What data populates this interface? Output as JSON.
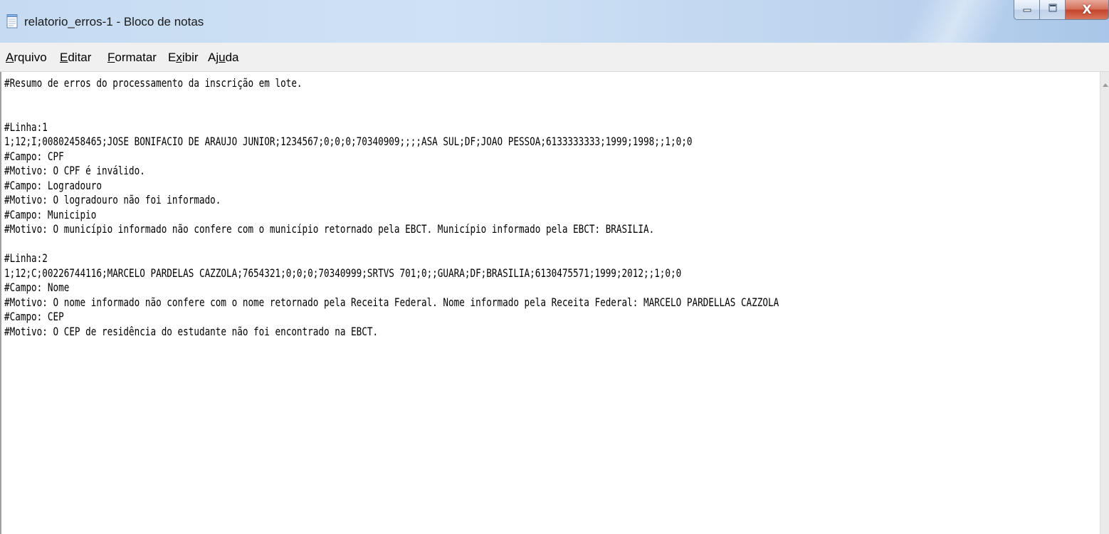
{
  "window": {
    "title": "relatorio_erros-1 - Bloco de notas",
    "icon": "notepad-icon",
    "caption": {
      "minimize_icon": "minimize-icon",
      "maximize_icon": "maximize-icon",
      "close_label": "X"
    }
  },
  "menubar": {
    "items": [
      {
        "label": "Arquivo",
        "accel": "A",
        "rest": "rquivo"
      },
      {
        "label": "Editar",
        "accel": "E",
        "rest": "ditar"
      },
      {
        "label": "Formatar",
        "accel": "F",
        "rest": "ormatar"
      },
      {
        "label": "Exibir",
        "pre": "E",
        "accel": "x",
        "rest": "ibir"
      },
      {
        "label": "Ajuda",
        "pre": "Aj",
        "accel": "u",
        "rest": "da"
      }
    ]
  },
  "editor": {
    "lines": [
      "#Resumo de erros do processamento da inscrição em lote.",
      "",
      "",
      "#Linha:1",
      "1;12;I;00802458465;JOSE BONIFACIO DE ARAUJO JUNIOR;1234567;0;0;0;70340909;;;;ASA SUL;DF;JOAO PESSOA;6133333333;1999;1998;;1;0;0",
      "#Campo: CPF",
      "#Motivo: O CPF é inválido.",
      "#Campo: Logradouro",
      "#Motivo: O logradouro não foi informado.",
      "#Campo: Municipio",
      "#Motivo: O município informado não confere com o município retornado pela EBCT. Município informado pela EBCT: BRASILIA.",
      "",
      "#Linha:2",
      "1;12;C;00226744116;MARCELO PARDELAS CAZZOLA;7654321;0;0;0;70340999;SRTVS 701;0;;GUARA;DF;BRASILIA;6130475571;1999;2012;;1;0;0",
      "#Campo: Nome",
      "#Motivo: O nome informado não confere com o nome retornado pela Receita Federal. Nome informado pela Receita Federal: MARCELO PARDELLAS CAZZOLA",
      "#Campo: CEP",
      "#Motivo: O CEP de residência do estudante não foi encontrado na EBCT."
    ]
  },
  "scrollbar": {
    "up_icon": "scroll-up-arrow-icon"
  }
}
